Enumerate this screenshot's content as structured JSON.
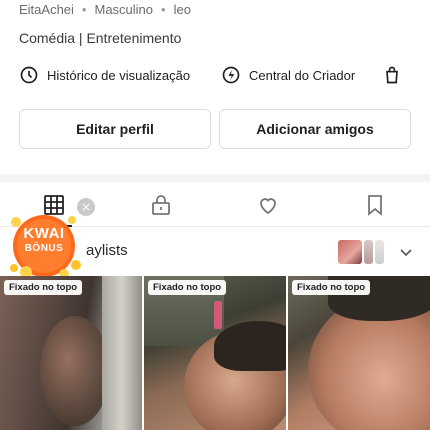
{
  "profile": {
    "username": "EitaAchei",
    "gender": "Masculino",
    "sign": "leo",
    "category": "Comédia | Entretenimento"
  },
  "quick_links": {
    "history_label": "Histórico de visualização",
    "history_icon": "clock-icon",
    "creator_label": "Central do Criador",
    "creator_icon": "lightning-icon",
    "shop_icon": "shopping-bag-icon"
  },
  "actions": {
    "edit_profile": "Editar perfil",
    "add_friends": "Adicionar amigos"
  },
  "tabs": [
    {
      "name": "posts",
      "icon": "grid-icon",
      "active": true
    },
    {
      "name": "private",
      "icon": "lock-icon",
      "active": false
    },
    {
      "name": "liked",
      "icon": "heart-icon",
      "active": false
    },
    {
      "name": "saved",
      "icon": "bookmark-icon",
      "active": false
    }
  ],
  "playlists": {
    "label": "aylists"
  },
  "promo": {
    "line1": "KWAI",
    "line2": "BÔNUS",
    "color": "#ff6a1a"
  },
  "videos": [
    {
      "badge": "Fixado no topo"
    },
    {
      "badge": "Fixado no topo"
    },
    {
      "badge": "Fixado no topo"
    }
  ],
  "colors": {
    "text": "#222222",
    "secondary": "#6b6b6b",
    "border": "#dedede",
    "promo": "#ff6a1a"
  }
}
